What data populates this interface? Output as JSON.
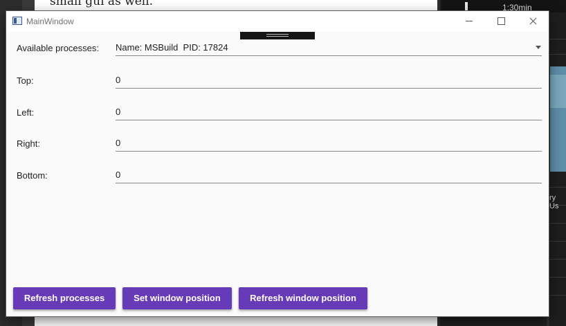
{
  "background": {
    "doc_text": "small gui as well.",
    "timeline_label": "1:30min",
    "side_text": "ry Us"
  },
  "window": {
    "title": "MainWindow"
  },
  "form": {
    "processes_label": "Available processes:",
    "processes_value": "Name: MSBuild  PID: 17824",
    "top_label": "Top:",
    "top_value": "0",
    "left_label": "Left:",
    "left_value": "0",
    "right_label": "Right:",
    "right_value": "0",
    "bottom_label": "Bottom:",
    "bottom_value": "0"
  },
  "buttons": {
    "refresh_processes": "Refresh processes",
    "set_position": "Set window position",
    "refresh_position": "Refresh window position"
  },
  "colors": {
    "accent": "#673ab7",
    "window_bg": "#fafafa"
  }
}
